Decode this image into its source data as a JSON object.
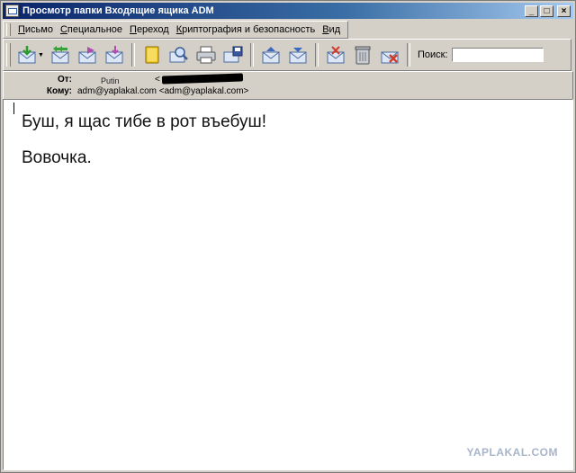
{
  "window": {
    "title": "Просмотр папки Входящие ящика ADM",
    "buttons": {
      "minimize": "_",
      "maximize": "□",
      "close": "×"
    }
  },
  "menu": {
    "items": [
      {
        "label": "Письмо"
      },
      {
        "label": "Специальное"
      },
      {
        "label": "Переход"
      },
      {
        "label": "Криптография и безопасность"
      },
      {
        "label": "Вид"
      }
    ]
  },
  "toolbar": {
    "buttons": [
      {
        "icon": "get-mail-icon"
      },
      {
        "icon": "reply-icon"
      },
      {
        "icon": "forward-icon"
      },
      {
        "icon": "new-message-icon"
      },
      {
        "icon": "address-book-icon"
      },
      {
        "icon": "find-icon"
      },
      {
        "icon": "print-icon"
      },
      {
        "icon": "save-icon"
      },
      {
        "icon": "previous-message-icon"
      },
      {
        "icon": "next-message-icon"
      },
      {
        "icon": "mark-read-icon"
      },
      {
        "icon": "trash-icon"
      },
      {
        "icon": "delete-icon"
      }
    ],
    "search_label": "Поиск:",
    "search_value": ""
  },
  "headers": {
    "from_label": "От:",
    "from_name": "Putin",
    "from_addr_open": "<",
    "to_label": "Кому:",
    "to_value": "adm@yaplakal.com <adm@yaplakal.com>"
  },
  "message": {
    "line1": "Буш, я щас тибе в рот въебуш!",
    "line2": "Вовочка."
  },
  "watermark": "YAPLAKAL.COM",
  "colors": {
    "titlebar_start": "#0a246a",
    "titlebar_end": "#a6caf0",
    "chrome": "#d4d0c8"
  }
}
